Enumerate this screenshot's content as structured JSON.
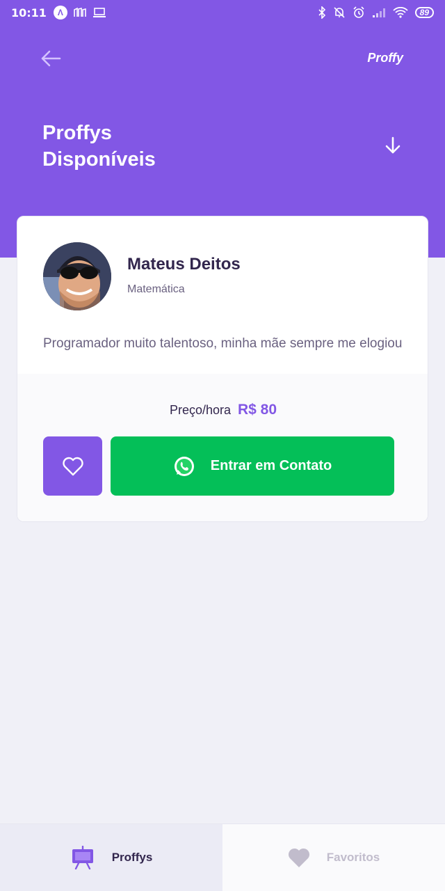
{
  "status_bar": {
    "time": "10:11",
    "battery": "89"
  },
  "header": {
    "brand": "Proffy",
    "title_line1": "Proffys",
    "title_line2": "Disponíveis"
  },
  "teacher": {
    "name": "Mateus Deitos",
    "subject": "Matemática",
    "bio": "Programador muito talentoso, minha mãe sempre me elogiou",
    "price_label": "Preço/hora",
    "price_value": "R$ 80",
    "contact_label": "Entrar em Contato"
  },
  "tabs": [
    {
      "label": "Proffys",
      "icon": "easel-icon",
      "active": true
    },
    {
      "label": "Favoritos",
      "icon": "heart-icon",
      "active": false
    }
  ],
  "colors": {
    "primary": "#8257e5",
    "whatsapp_green": "#04bf58",
    "background": "#f0f0f7"
  }
}
